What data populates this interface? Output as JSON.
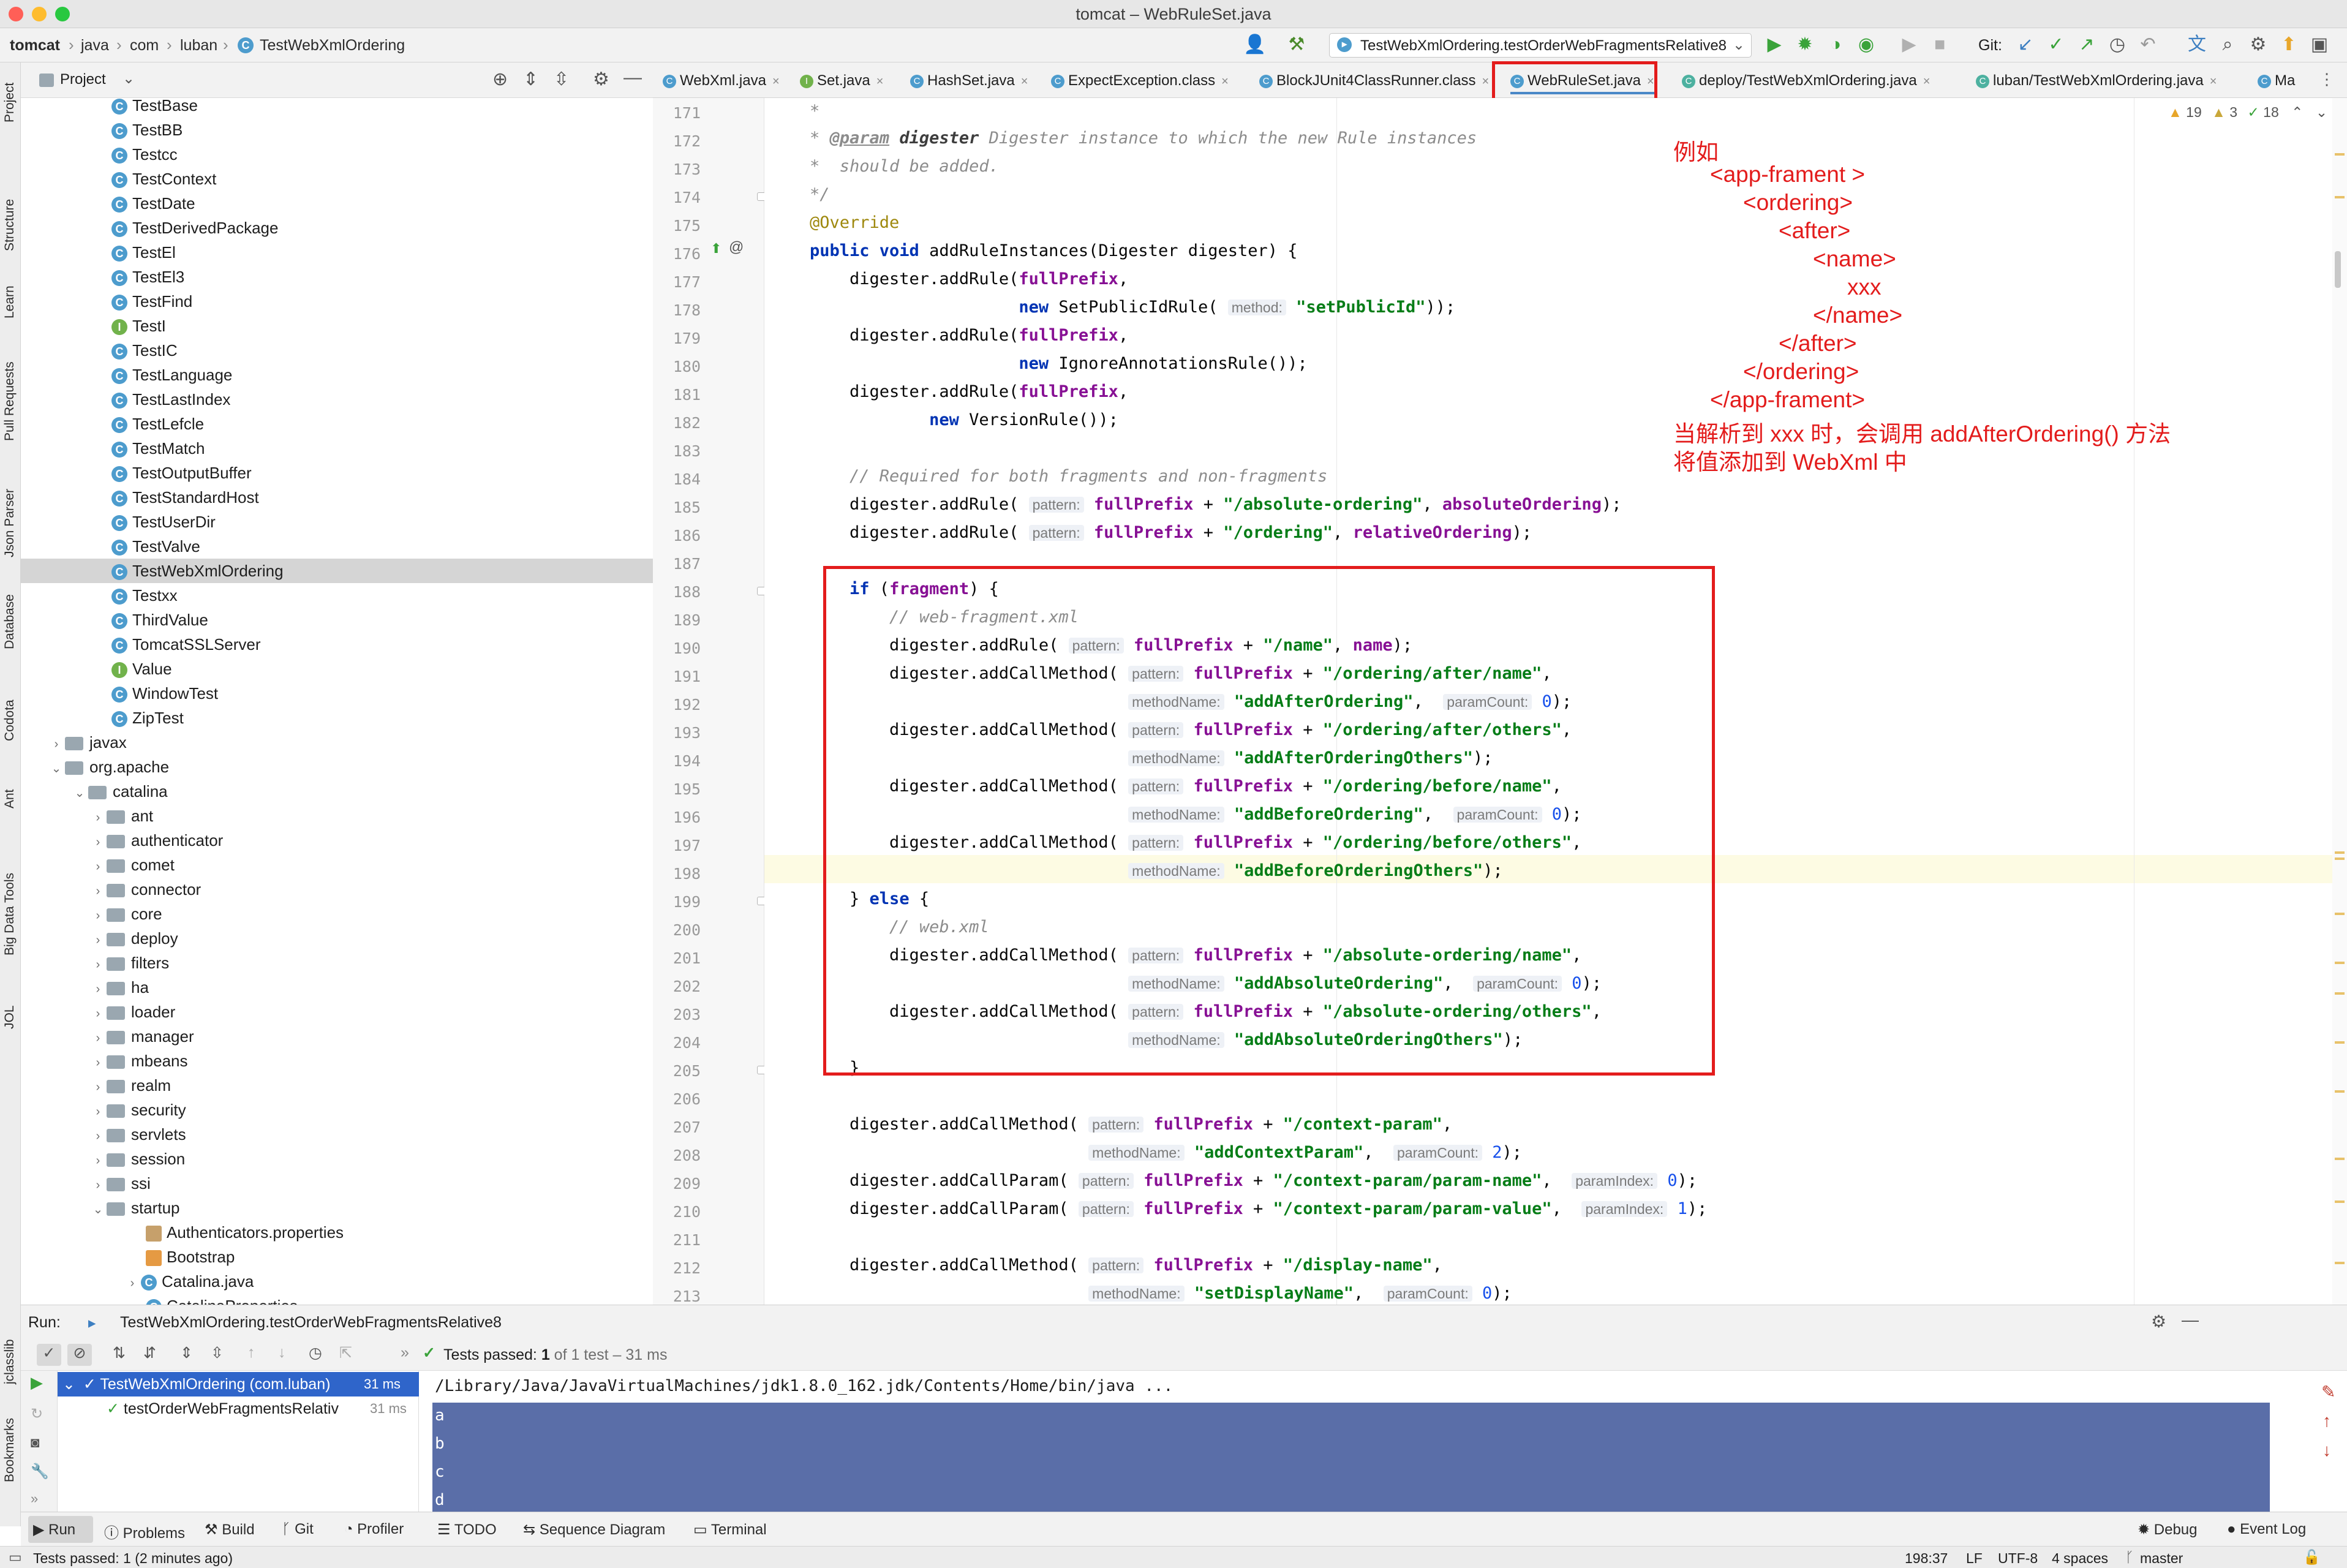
{
  "window": {
    "title": "tomcat – WebRuleSet.java"
  },
  "breadcrumb": [
    "tomcat",
    "java",
    "com",
    "luban",
    "TestWebXmlOrdering"
  ],
  "toolbar": {
    "run_config": "TestWebXmlOrdering.testOrderWebFragmentsRelative8",
    "git_label": "Git:"
  },
  "left_strip": [
    "Project",
    "Structure",
    "Learn",
    "Pull Requests",
    "Json Parser",
    "Database",
    "Codota",
    "Ant",
    "Big Data Tools",
    "JOL",
    "jclasslib",
    "Bookmarks"
  ],
  "project": {
    "title": "Project",
    "items": [
      {
        "label": "TestBase",
        "kind": "class",
        "indent": 2
      },
      {
        "label": "TestBB",
        "kind": "class",
        "indent": 2
      },
      {
        "label": "Testcc",
        "kind": "class",
        "indent": 2
      },
      {
        "label": "TestContext",
        "kind": "class",
        "indent": 2
      },
      {
        "label": "TestDate",
        "kind": "class",
        "indent": 2
      },
      {
        "label": "TestDerivedPackage",
        "kind": "class",
        "indent": 2
      },
      {
        "label": "TestEl",
        "kind": "class",
        "indent": 2
      },
      {
        "label": "TestEl3",
        "kind": "class",
        "indent": 2
      },
      {
        "label": "TestFind",
        "kind": "class",
        "indent": 2
      },
      {
        "label": "TestI",
        "kind": "interface",
        "indent": 2
      },
      {
        "label": "TestIC",
        "kind": "class",
        "indent": 2
      },
      {
        "label": "TestLanguage",
        "kind": "class",
        "indent": 2
      },
      {
        "label": "TestLastIndex",
        "kind": "class",
        "indent": 2
      },
      {
        "label": "TestLefcle",
        "kind": "class",
        "indent": 2
      },
      {
        "label": "TestMatch",
        "kind": "class",
        "indent": 2
      },
      {
        "label": "TestOutputBuffer",
        "kind": "class",
        "indent": 2
      },
      {
        "label": "TestStandardHost",
        "kind": "class",
        "indent": 2
      },
      {
        "label": "TestUserDir",
        "kind": "class",
        "indent": 2
      },
      {
        "label": "TestValve",
        "kind": "class",
        "indent": 2
      },
      {
        "label": "TestWebXmlOrdering",
        "kind": "class",
        "indent": 2,
        "selected": true
      },
      {
        "label": "Testxx",
        "kind": "class",
        "indent": 2
      },
      {
        "label": "ThirdValue",
        "kind": "class",
        "indent": 2
      },
      {
        "label": "TomcatSSLServer",
        "kind": "class",
        "indent": 2
      },
      {
        "label": "Value",
        "kind": "interface",
        "indent": 2
      },
      {
        "label": "WindowTest",
        "kind": "class",
        "indent": 2
      },
      {
        "label": "ZipTest",
        "kind": "class",
        "indent": 2
      },
      {
        "label": "javax",
        "kind": "folder",
        "indent": 0,
        "arrow": "›"
      },
      {
        "label": "org.apache",
        "kind": "folder",
        "indent": 0,
        "arrow": "⌄"
      },
      {
        "label": "catalina",
        "kind": "folder",
        "indent": 1,
        "arrow": "⌄"
      },
      {
        "label": "ant",
        "kind": "folder",
        "indent": 2,
        "arrow": "›"
      },
      {
        "label": "authenticator",
        "kind": "folder",
        "indent": 2,
        "arrow": "›"
      },
      {
        "label": "comet",
        "kind": "folder",
        "indent": 2,
        "arrow": "›"
      },
      {
        "label": "connector",
        "kind": "folder",
        "indent": 2,
        "arrow": "›"
      },
      {
        "label": "core",
        "kind": "folder",
        "indent": 2,
        "arrow": "›"
      },
      {
        "label": "deploy",
        "kind": "folder",
        "indent": 2,
        "arrow": "›"
      },
      {
        "label": "filters",
        "kind": "folder",
        "indent": 2,
        "arrow": "›"
      },
      {
        "label": "ha",
        "kind": "folder",
        "indent": 2,
        "arrow": "›"
      },
      {
        "label": "loader",
        "kind": "folder",
        "indent": 2,
        "arrow": "›"
      },
      {
        "label": "manager",
        "kind": "folder",
        "indent": 2,
        "arrow": "›"
      },
      {
        "label": "mbeans",
        "kind": "folder",
        "indent": 2,
        "arrow": "›"
      },
      {
        "label": "realm",
        "kind": "folder",
        "indent": 2,
        "arrow": "›"
      },
      {
        "label": "security",
        "kind": "folder",
        "indent": 2,
        "arrow": "›"
      },
      {
        "label": "servlets",
        "kind": "folder",
        "indent": 2,
        "arrow": "›"
      },
      {
        "label": "session",
        "kind": "folder",
        "indent": 2,
        "arrow": "›"
      },
      {
        "label": "ssi",
        "kind": "folder",
        "indent": 2,
        "arrow": "›"
      },
      {
        "label": "startup",
        "kind": "folder",
        "indent": 2,
        "arrow": "⌄"
      },
      {
        "label": "Authenticators.properties",
        "kind": "properties",
        "indent": 3
      },
      {
        "label": "Bootstrap",
        "kind": "java",
        "indent": 3
      },
      {
        "label": "Catalina.java",
        "kind": "class",
        "indent": 3,
        "arrow": "›"
      },
      {
        "label": "CatalinaProperties",
        "kind": "class",
        "indent": 3
      }
    ]
  },
  "tabs": [
    {
      "label": "WebXml.java"
    },
    {
      "label": "Set.java"
    },
    {
      "label": "HashSet.java"
    },
    {
      "label": "ExpectException.class"
    },
    {
      "label": "BlockJUnit4ClassRunner.class"
    },
    {
      "label": "WebRuleSet.java",
      "active": true
    },
    {
      "label": "deploy/TestWebXmlOrdering.java"
    },
    {
      "label": "luban/TestWebXmlOrdering.java"
    },
    {
      "label": "Ma"
    }
  ],
  "inspections": {
    "warnings": "19",
    "weak": "3",
    "ok": "18"
  },
  "line_numbers": [
    "171",
    "172",
    "173",
    "174",
    "175",
    "176",
    "177",
    "178",
    "179",
    "180",
    "181",
    "182",
    "183",
    "184",
    "185",
    "186",
    "187",
    "188",
    "189",
    "190",
    "191",
    "192",
    "193",
    "194",
    "195",
    "196",
    "197",
    "198",
    "199",
    "200",
    "201",
    "202",
    "203",
    "204",
    "205",
    "206",
    "207",
    "208",
    "209",
    "210",
    "211",
    "212",
    "213"
  ],
  "annotation": {
    "lines": [
      "例如",
      "<app-frament >",
      "<ordering>",
      "<after>",
      "<name>",
      "xxx",
      "</name>",
      "</after>",
      "</ordering>",
      "</app-frament>",
      "当解析到 xxx 时，会调用 addAfterOrdering() 方法",
      "将值添加到 WebXml 中"
    ]
  },
  "run": {
    "label": "Run:",
    "config": "TestWebXmlOrdering.testOrderWebFragmentsRelative8",
    "passed": "Tests passed: ",
    "passed_count": "1",
    "passed_rest": " of 1 test – 31 ms",
    "tree": [
      {
        "label": "TestWebXmlOrdering (com.luban)",
        "time": "31 ms"
      },
      {
        "label": "testOrderWebFragmentsRelativ",
        "time": "31 ms"
      }
    ],
    "console": [
      "/Library/Java/JavaVirtualMachines/jdk1.8.0_162.jdk/Contents/Home/bin/java ...",
      "a",
      "b",
      "c",
      "d"
    ]
  },
  "bottom_tabs": [
    "Run",
    "Problems",
    "Build",
    "Git",
    "Profiler",
    "TODO",
    "Sequence Diagram",
    "Terminal",
    "Debug",
    "Event Log"
  ],
  "status": {
    "message": "Tests passed: 1 (2 minutes ago)",
    "position": "198:37",
    "line_sep": "LF",
    "encoding": "UTF-8",
    "indent": "4 spaces",
    "branch": "master"
  },
  "colors": {
    "annotation_red": "#e31c1c",
    "keyword": "#0033b3",
    "string": "#067d17",
    "field": "#871094",
    "console_selection": "#5a6ea8"
  }
}
